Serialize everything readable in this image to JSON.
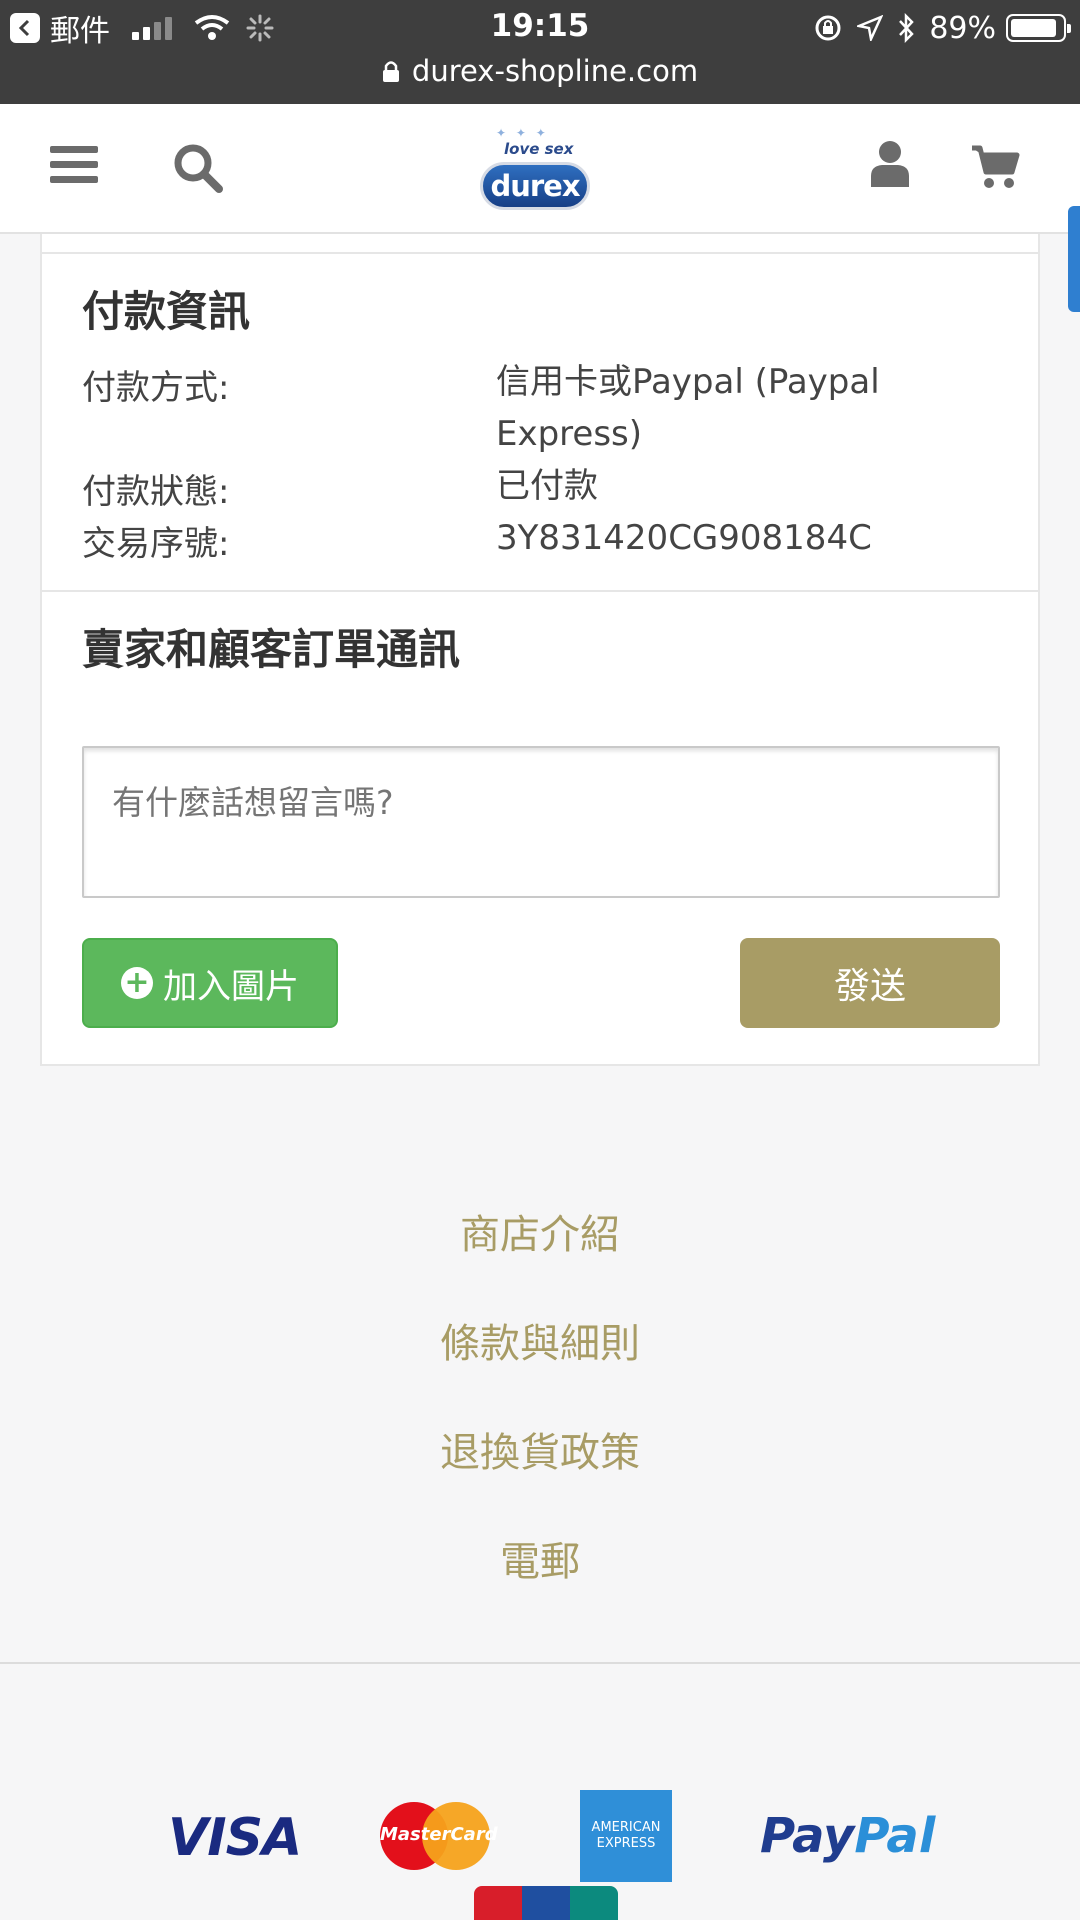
{
  "status_bar": {
    "back_app": "郵件",
    "time": "19:15",
    "battery": "89%",
    "battery_level": 0.89
  },
  "browser": {
    "url": "durex-shopline.com"
  },
  "header": {
    "logo_tagline": "love sex",
    "logo_text": "durex"
  },
  "payment_info": {
    "title": "付款資訊",
    "method_label": "付款方式:",
    "method_value": "信用卡或Paypal (Paypal Express)",
    "status_label": "付款狀態:",
    "status_value": "已付款",
    "txn_label": "交易序號:",
    "txn_value": "3Y831420CG908184C"
  },
  "messages": {
    "title": "賣家和顧客訂單通訊",
    "placeholder": "有什麼話想留言嗎?",
    "add_image_label": "加入圖片",
    "send_label": "發送"
  },
  "footer": {
    "links": [
      "商店介紹",
      "條款與細則",
      "退換貨政策",
      "電郵"
    ],
    "payments": {
      "visa": "VISA",
      "mastercard": "MasterCard",
      "amex_line1": "AMERICAN",
      "amex_line2": "EXPRESS",
      "paypal_a": "Pay",
      "paypal_b": "Pal"
    }
  },
  "colors": {
    "accent": "#a89c65",
    "green": "#5cb85c",
    "statusbar": "#3e3e3e"
  }
}
